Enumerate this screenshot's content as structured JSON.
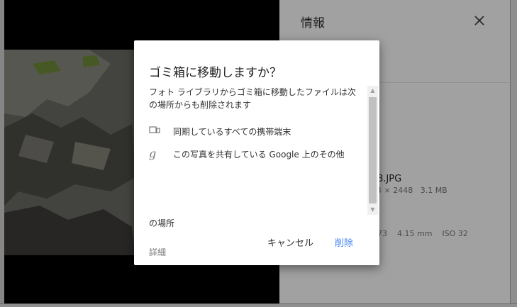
{
  "info_panel": {
    "title": "情報",
    "file_name": "8.JPG",
    "dimensions": "64 × 2448",
    "file_size": "3.1 MB",
    "camera_value": "373",
    "focal_length": "4.15 mm",
    "iso": "ISO 32"
  },
  "dialog": {
    "title": "ゴミ箱に移動しますか？",
    "message": "フォト ライブラリからゴミ箱に移動したファイルは次の場所からも削除されます",
    "items": [
      {
        "icon": "devices-icon",
        "text": "同期しているすべての携帯端末"
      },
      {
        "icon": "google-g-icon",
        "text": "この写真を共有している Google 上のその他"
      }
    ],
    "item_continuation": "の場所",
    "details_link": "詳細",
    "cancel_label": "キャンセル",
    "delete_label": "削除"
  },
  "colors": {
    "accent": "#4285f4",
    "scrim": "rgba(0,0,0,0.37)"
  }
}
